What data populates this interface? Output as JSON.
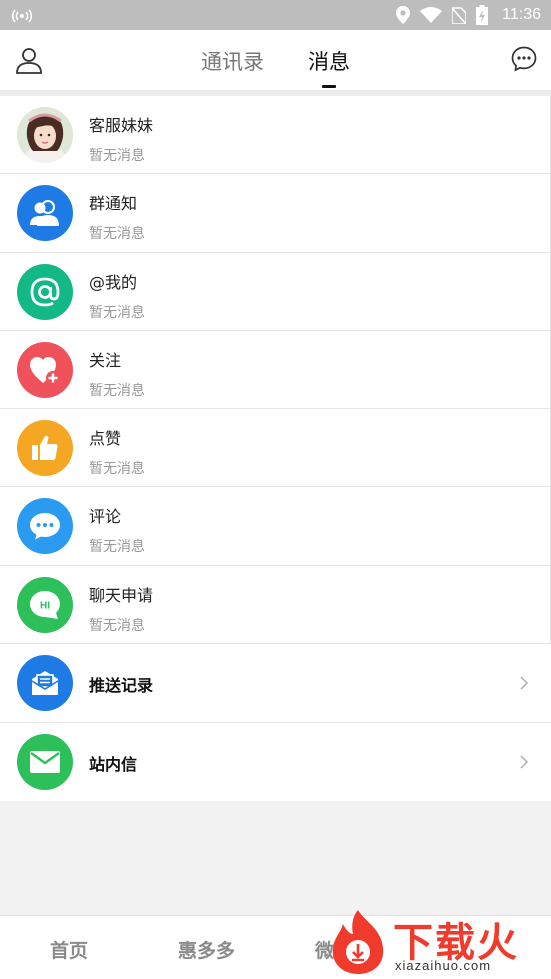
{
  "status_bar": {
    "time": "11:36"
  },
  "header": {
    "tabs": [
      {
        "label": "通讯录",
        "active": false
      },
      {
        "label": "消息",
        "active": true
      }
    ]
  },
  "messages": [
    {
      "title": "客服妹妹",
      "subtitle": "暂无消息",
      "icon": "customer-service-avatar"
    },
    {
      "title": "群通知",
      "subtitle": "暂无消息",
      "icon": "group-icon",
      "color": "#1e7be6"
    },
    {
      "title": "@我的",
      "subtitle": "暂无消息",
      "icon": "at-icon",
      "color": "#12b886"
    },
    {
      "title": "关注",
      "subtitle": "暂无消息",
      "icon": "heart-plus-icon",
      "color": "#f0525c"
    },
    {
      "title": "点赞",
      "subtitle": "暂无消息",
      "icon": "thumbs-up-icon",
      "color": "#f5a623"
    },
    {
      "title": "评论",
      "subtitle": "暂无消息",
      "icon": "comment-icon",
      "color": "#2a9bf0"
    },
    {
      "title": "聊天申请",
      "subtitle": "暂无消息",
      "icon": "hi-chat-icon",
      "color": "#2cbf5a"
    }
  ],
  "links": [
    {
      "title": "推送记录",
      "icon": "push-record-icon",
      "color": "#1e7be6"
    },
    {
      "title": "站内信",
      "icon": "mail-icon",
      "color": "#2cbf5a"
    }
  ],
  "bottom_nav": {
    "home": "首页",
    "hui": "惠多多",
    "wei": "微"
  },
  "watermark": {
    "text": "下载火",
    "url": "xiazaihuo.com"
  }
}
